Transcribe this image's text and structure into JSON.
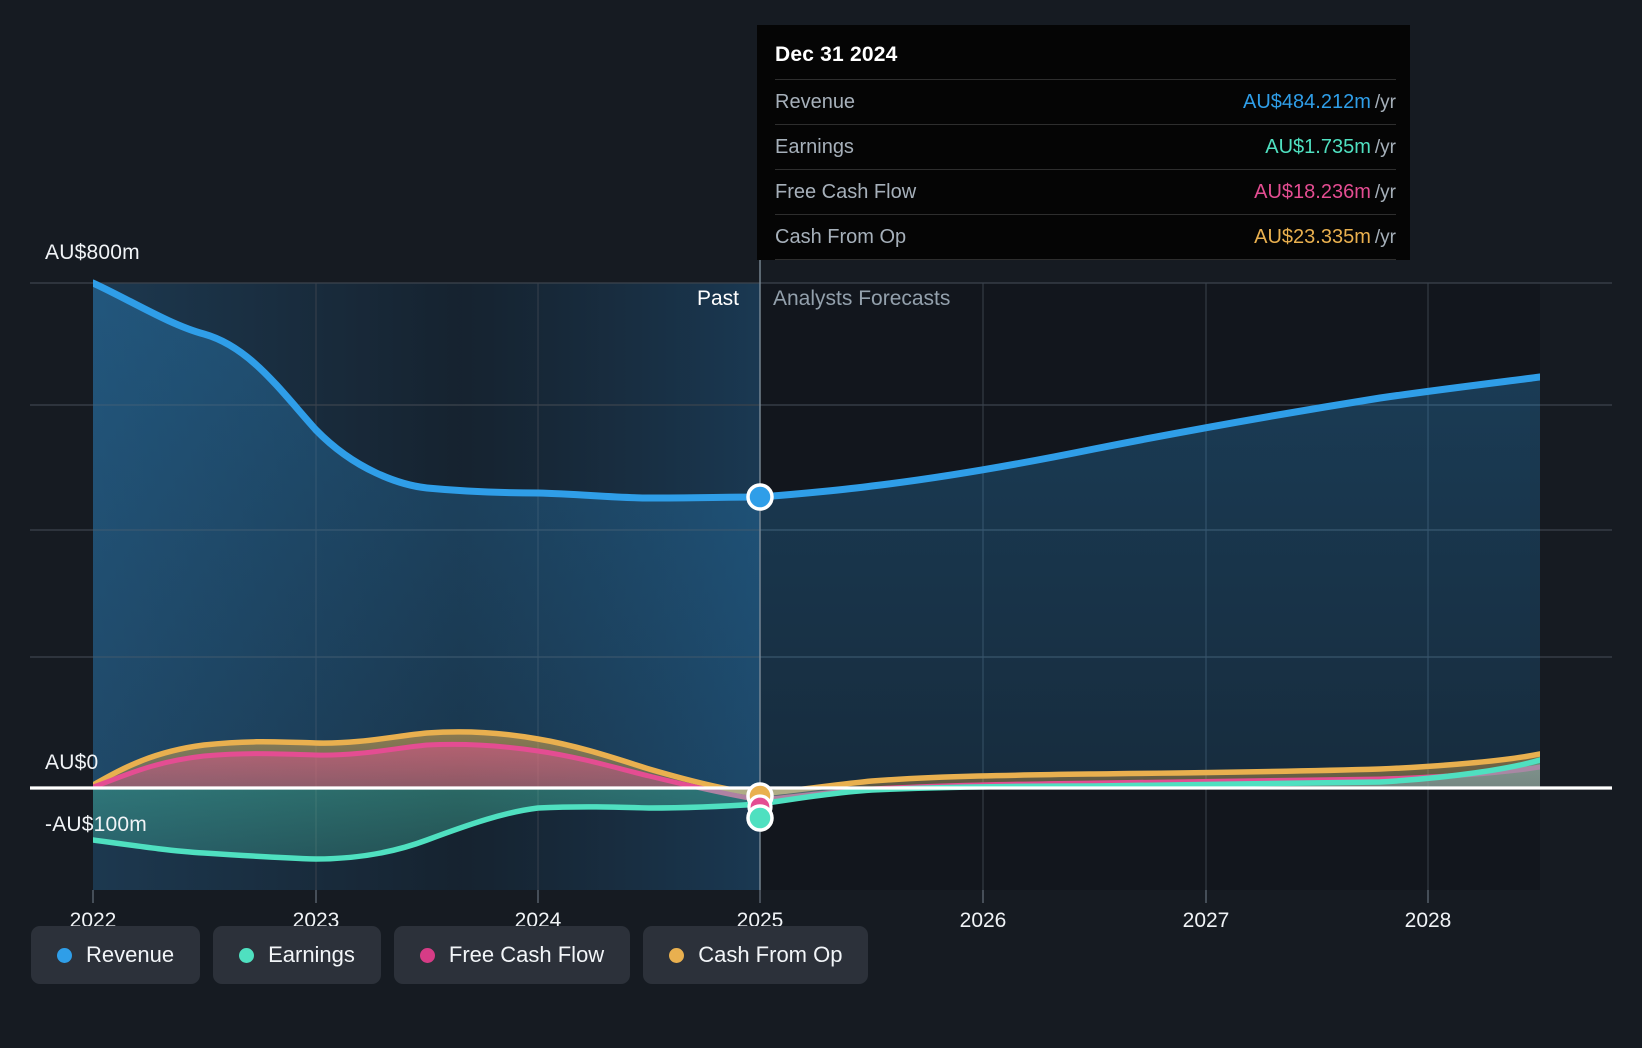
{
  "axes": {
    "y_labels": [
      {
        "text": "AU$800m",
        "value": 800
      },
      {
        "text": "AU$0",
        "value": 0
      },
      {
        "text": "-AU$100m",
        "value": -100
      }
    ],
    "x_labels": [
      "2022",
      "2023",
      "2024",
      "2025",
      "2026",
      "2027",
      "2028"
    ],
    "ylim": [
      -100,
      800
    ],
    "gridline_values": [
      800,
      600,
      400,
      200
    ]
  },
  "eras": {
    "past_label": "Past",
    "forecast_label": "Analysts Forecasts",
    "divider_year": "2025"
  },
  "tooltip": {
    "date": "Dec 31 2024",
    "rows": [
      {
        "label": "Revenue",
        "value": "AU$484.212m",
        "unit": "/yr",
        "color": "#2f9ee8"
      },
      {
        "label": "Earnings",
        "value": "AU$1.735m",
        "unit": "/yr",
        "color": "#4fe0c0"
      },
      {
        "label": "Free Cash Flow",
        "value": "AU$18.236m",
        "unit": "/yr",
        "color": "#e44d92"
      },
      {
        "label": "Cash From Op",
        "value": "AU$23.335m",
        "unit": "/yr",
        "color": "#e9b04f"
      }
    ]
  },
  "legend": {
    "items": [
      {
        "label": "Revenue",
        "color": "#2f9ee8",
        "icon": "circle-icon"
      },
      {
        "label": "Earnings",
        "color": "#4fe0c0",
        "icon": "circle-icon"
      },
      {
        "label": "Free Cash Flow",
        "color": "#d63c86",
        "icon": "circle-icon"
      },
      {
        "label": "Cash From Op",
        "color": "#e9b04f",
        "icon": "circle-icon"
      }
    ]
  },
  "colors": {
    "background": "#161b22",
    "revenue": "#2f9ee8",
    "earnings": "#4fe0c0",
    "free_cash_flow": "#e44d92",
    "cash_from_op": "#e9b04f",
    "zero_line": "#ffffff",
    "gridline": "#3a424c",
    "past_tint": "#1b3category"
  },
  "chart_data": {
    "type": "area",
    "title": "",
    "xlabel": "",
    "ylabel": "AU$",
    "ylim": [
      -100,
      800
    ],
    "xlim": [
      2022,
      2028.5
    ],
    "grid": true,
    "legend_position": "bottom-left",
    "currency": "AU$",
    "units": "millions per year",
    "divider_x": 2025,
    "highlight_x": 2025,
    "highlight_label": "Dec 31 2024",
    "x": [
      2022,
      2022.5,
      2023,
      2023.5,
      2024,
      2024.5,
      2025,
      2025.5,
      2026,
      2026.5,
      2027,
      2027.5,
      2028,
      2028.5
    ],
    "series": [
      {
        "name": "Revenue",
        "color": "#2f9ee8",
        "values": [
          800,
          712,
          590,
          510,
          487,
          481,
          484.212,
          500,
          523,
          552,
          578,
          604,
          630,
          658
        ],
        "marker_at_divider": 484.212
      },
      {
        "name": "Earnings",
        "color": "#4fe0c0",
        "values": [
          -81,
          -89,
          -99,
          -79,
          -23,
          -13,
          1.735,
          12,
          16,
          17,
          19,
          22,
          26,
          34
        ],
        "marker_at_divider": 1.735
      },
      {
        "name": "Free Cash Flow",
        "color": "#e44d92",
        "values": [
          2,
          24,
          26,
          35,
          34,
          26,
          18.236,
          25,
          27,
          26,
          25,
          26,
          28,
          31
        ],
        "marker_at_divider": 18.236
      },
      {
        "name": "Cash From Op",
        "color": "#e9b04f",
        "values": [
          5,
          32,
          32,
          41,
          41,
          33,
          23.335,
          31,
          33,
          33,
          33,
          35,
          38,
          44
        ],
        "marker_at_divider": 23.335
      }
    ]
  }
}
